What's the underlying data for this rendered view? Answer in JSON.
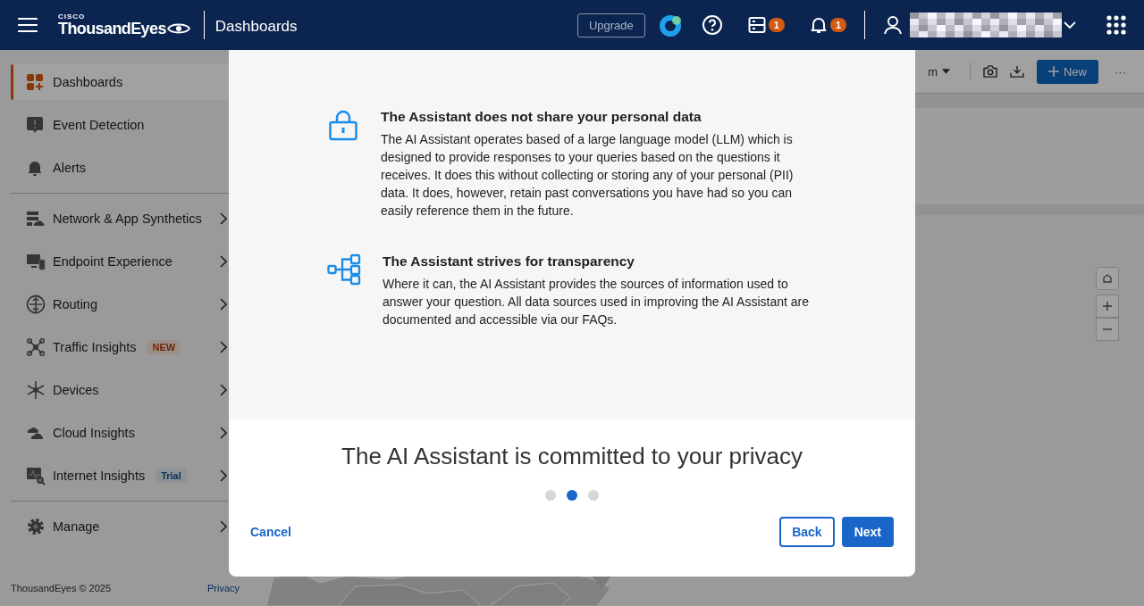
{
  "header": {
    "brand_small": "CISCO",
    "brand": "ThousandEyes",
    "page_title": "Dashboards",
    "upgrade": "Upgrade",
    "agents_count": "1",
    "alerts_count": "1"
  },
  "sidebar": {
    "groups": [
      [
        {
          "kind": "dashboards",
          "label": "Dashboards",
          "selected": true,
          "has_children": false
        },
        {
          "kind": "event",
          "label": "Event Detection",
          "selected": false,
          "has_children": false
        },
        {
          "kind": "alerts",
          "label": "Alerts",
          "selected": false,
          "has_children": false
        }
      ],
      [
        {
          "kind": "network",
          "label": "Network & App Synthetics",
          "selected": false,
          "has_children": true
        },
        {
          "kind": "endpoint",
          "label": "Endpoint Experience",
          "selected": false,
          "has_children": true
        },
        {
          "kind": "routing",
          "label": "Routing",
          "selected": false,
          "has_children": true
        },
        {
          "kind": "traffic",
          "label": "Traffic Insights",
          "selected": false,
          "has_children": true,
          "badge": {
            "text": "NEW",
            "kind": "new"
          }
        },
        {
          "kind": "devices",
          "label": "Devices",
          "selected": false,
          "has_children": true
        },
        {
          "kind": "cloud",
          "label": "Cloud Insights",
          "selected": false,
          "has_children": true
        },
        {
          "kind": "internet",
          "label": "Internet Insights",
          "selected": false,
          "has_children": true,
          "badge": {
            "text": "Trial",
            "kind": "trial"
          }
        }
      ],
      [
        {
          "kind": "manage",
          "label": "Manage",
          "selected": false,
          "has_children": true
        }
      ]
    ],
    "footer": {
      "copyright": "ThousandEyes © 2025",
      "privacy": "Privacy"
    }
  },
  "toolbar": {
    "view_label": "m",
    "new_button": "New",
    "more": "···"
  },
  "modal": {
    "features": [
      {
        "kind": "lock",
        "title": "The Assistant does not share your personal data",
        "body": "The AI Assistant operates based of a large language model (LLM) which is designed to provide responses to your queries based on the questions it receives. It does this without collecting or storing any of your personal (PII) data. It does, however, retain past conversations you have had so you can easily reference them in the future."
      },
      {
        "kind": "sources",
        "title": "The Assistant strives for transparency",
        "body": "Where it can, the AI Assistant provides the sources of information used to answer your question. All data sources used in improving the AI Assistant are documented and accessible via our FAQs."
      }
    ],
    "heading": "The AI Assistant is committed to your privacy",
    "steps": [
      {
        "selected": false
      },
      {
        "selected": true
      },
      {
        "selected": false
      }
    ],
    "cancel": "Cancel",
    "back": "Back",
    "next": "Next"
  }
}
